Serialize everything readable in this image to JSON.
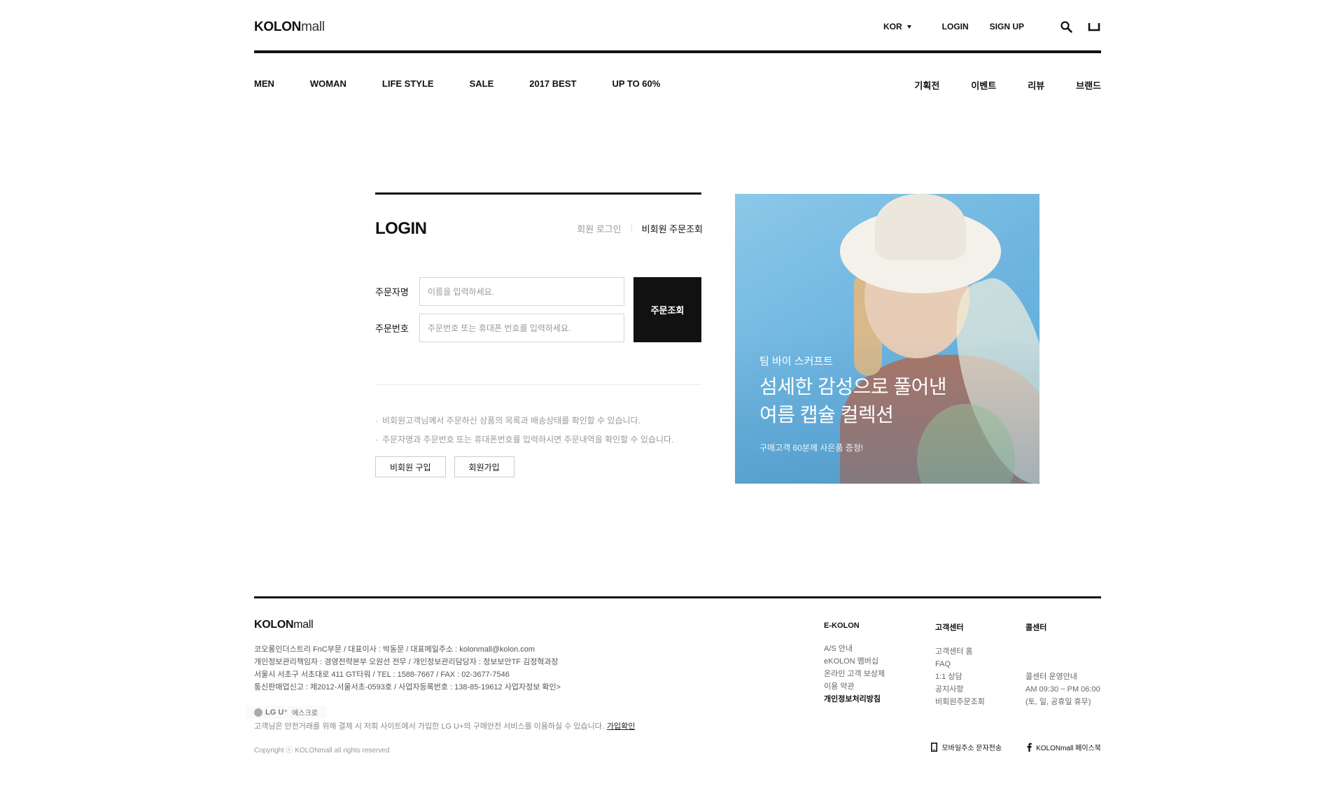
{
  "header": {
    "logo_bold": "KOLON",
    "logo_thin": "mall",
    "language": "KOR",
    "login": "LOGIN",
    "signup": "SIGN UP",
    "search_icon": "search-icon",
    "cart_icon": "cart-icon"
  },
  "nav": {
    "main": [
      "MEN",
      "WOMAN",
      "LIFE STYLE",
      "SALE",
      "2017 BEST",
      "UP TO 60%"
    ],
    "right": [
      "기획전",
      "이벤트",
      "리뷰",
      "브랜드"
    ]
  },
  "login": {
    "title": "LOGIN",
    "tab_member": "회원 로그인",
    "tab_guest": "비회원 주문조회",
    "name_label": "주문자명",
    "name_placeholder": "이름을 입력하세요.",
    "order_label": "주문번호",
    "order_placeholder": "주문번호 또는 휴대폰 번호를 입력하세요.",
    "submit": "주문조회",
    "notes": [
      "비회원고객님께서 주문하신 상품의 목록과 배송상태를 확인할 수 있습니다.",
      "주문자명과 주문번호 또는 휴대폰번호를 입력하시면 주문내역을 확인할 수 있습니다."
    ],
    "btn_guest_buy": "비회원 구입",
    "btn_join": "회원가입"
  },
  "banner": {
    "sub": "팀 바이 스커프트",
    "title_line1": "섬세한 감성으로 풀어낸",
    "title_line2": "여름 캡슐 컬렉션",
    "gift": "구매고객 60분께 사은품 증정!"
  },
  "footer": {
    "logo_bold": "KOLON",
    "logo_thin": "mall",
    "info": [
      "코오롱인더스트리 FnC부문 / 대표이사 : 박동문 / 대표메일주소 : kolonmall@kolon.com",
      "개인정보관리책임자 : 경영전략본부 오원선 전무 / 개인정보관리담당자 : 정보보안TF 김정혁과장",
      "서울시 서초구 서초대로 411 GT타워 / TEL : 1588-7667 / FAX : 02-3677-7546",
      "통신판매업신고 : 제2012-서울서초-0593호 / 사업자등록번호 : 138-85-19612  사업자정보 확인>"
    ],
    "escrow_brand": "LG U⁺",
    "escrow_label": "에스크로",
    "escrow_text": "고객님은 안전거래를 위해 결제 시 저희 사이트에서 가입한 LG U+의 구매안전 서비스를 이용하실 수 있습니다.",
    "escrow_link": "가입확인",
    "copyright": "Copyright ⓒ KOLONmall all rights reserved",
    "col1": {
      "title": "E-KOLON",
      "items": [
        "A/S 안내",
        "eKOLON 멤버십",
        "온라인 고객 보상제",
        "이용 약관",
        "개인정보처리방침"
      ]
    },
    "col2": {
      "title": "고객센터",
      "items": [
        "고객센터 홈",
        "FAQ",
        "1:1 상담",
        "공지사항",
        "비회원주문조회"
      ]
    },
    "col3": {
      "title": "콜센터",
      "items": [
        "콜센터 운영안내",
        "AM 09:30 ~ PM 06:00",
        "(토, 일, 공휴일 휴무)"
      ]
    },
    "mobile_sms": "모바일주소 문자전송",
    "facebook": "KOLONmall 페이스북"
  },
  "colors": {
    "text": "#111111",
    "muted": "#999999",
    "button_dark": "#111111",
    "banner_sky": "#6fb6e0"
  }
}
